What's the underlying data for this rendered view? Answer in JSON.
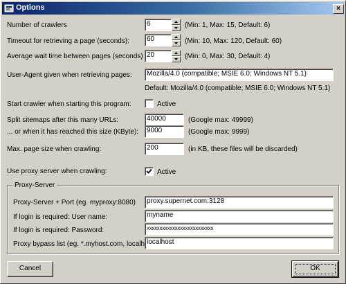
{
  "window": {
    "title": "Options",
    "close_label": "×"
  },
  "crawlers": {
    "label": "Number of crawlers",
    "value": "6",
    "hint": "(Min: 1, Max: 15, Default: 6)"
  },
  "timeout": {
    "label": "Timeout for retrieving a page (seconds):",
    "value": "60",
    "hint": "(Min: 10, Max: 120, Default: 60)"
  },
  "wait": {
    "label": "Average wait time between pages (seconds)",
    "value": "20",
    "hint": "(Min: 0, Max: 30, Default: 4)"
  },
  "user_agent": {
    "label": "User-Agent given when retrieving pages:",
    "value": "Mozilla/4.0 (compatible; MSIE 6.0; Windows NT 5.1)",
    "default_text": "Default: Mozilla/4.0 (compatible; MSIE 6.0; Windows NT 5.1)"
  },
  "start_crawler": {
    "label": "Start crawler when starting this program:",
    "checkbox_label": "Active",
    "checked": false
  },
  "split_urls": {
    "label": "Split sitemaps after this many URLs:",
    "value": "40000",
    "hint": "(Google max: 49999)"
  },
  "split_size": {
    "label": "... or when it has reached this size (KByte):",
    "value": "9000",
    "hint": "(Google max: 9999)"
  },
  "max_page": {
    "label": "Max. page size when crawling:",
    "value": "200",
    "hint": "(in KB, these files will be discarded)"
  },
  "use_proxy": {
    "label": "Use proxy server when crawling:",
    "checkbox_label": "Active",
    "checked": true
  },
  "proxy": {
    "group_title": "Proxy-Server",
    "server_label": "Proxy-Server + Port (eg. myproxy:8080)",
    "server_value": "proxy.supernet.com:3128",
    "user_label": "If login is required: User name:",
    "user_value": "myname",
    "password_label": "If login is required: Password:",
    "password_value": "xxxxxxxxxxxxxxxxxxxxxxxxxx",
    "bypass_label": "Proxy bypass list (eg. *.myhost.com, localhost)",
    "bypass_value": "localhost"
  },
  "buttons": {
    "cancel": "Cancel",
    "ok": "OK"
  },
  "icons": {
    "app": "app-icon",
    "close": "close-icon",
    "spin_up": "arrow-up-icon",
    "spin_down": "arrow-down-icon",
    "check": "checkmark-icon"
  }
}
